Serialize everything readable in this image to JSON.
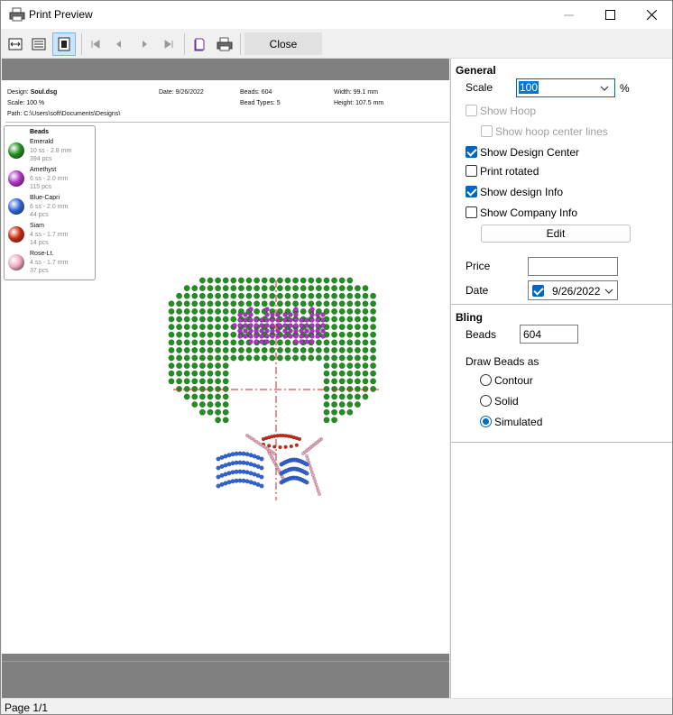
{
  "window": {
    "title": "Print Preview"
  },
  "toolbar": {
    "close_label": "Close"
  },
  "header": {
    "design_label": "Design:",
    "design_value": "Soul.dsg",
    "scale_text": "Scale: 100 %",
    "path_text": "Path: C:\\Users\\soft\\Documents\\Designs\\",
    "date_text": "Date: 9/26/2022",
    "beads_text": "Beads: 604",
    "bead_types_text": "Bead Types: 5",
    "width_text": "Width: 99.1 mm",
    "height_text": "Height: 107.5 mm"
  },
  "legend": {
    "title": "Beads",
    "items": [
      {
        "name": "Emerald",
        "size": "10 ss - 2.8 mm",
        "pcs": "394 pcs",
        "color": "#1f8f1f"
      },
      {
        "name": "Amethyst",
        "size": "6 ss - 2.0 mm",
        "pcs": "115 pcs",
        "color": "#b02fc6"
      },
      {
        "name": "Blue-Capri",
        "size": "6 ss - 2.0 mm",
        "pcs": "44 pcs",
        "color": "#2f63d6"
      },
      {
        "name": "Siam",
        "size": "4 ss - 1.7 mm",
        "pcs": "14 pcs",
        "color": "#c82a10"
      },
      {
        "name": "Rose-Lt.",
        "size": "4 ss - 1.7 mm",
        "pcs": "37 pcs",
        "color": "#f0a8c0"
      }
    ]
  },
  "general": {
    "title": "General",
    "scale_label": "Scale",
    "scale_value": "100",
    "scale_unit": "%",
    "show_hoop": "Show Hoop",
    "show_hoop_center": "Show hoop center lines",
    "show_design_center": "Show Design Center",
    "print_rotated": "Print rotated",
    "show_design_info": "Show design Info",
    "show_company_info": "Show Company Info",
    "edit_label": "Edit",
    "price_label": "Price",
    "price_value": "",
    "date_label": "Date",
    "date_value": "9/26/2022"
  },
  "bling": {
    "title": "Bling",
    "beads_label": "Beads",
    "beads_value": "604",
    "draw_as_label": "Draw Beads as",
    "contour": "Contour",
    "solid": "Solid",
    "simulated": "Simulated",
    "selected": "Simulated"
  },
  "status": {
    "page": "Page 1/1"
  },
  "colors": {
    "accent": "#0067c0",
    "preview_bg": "#808080",
    "center_line": "#d42020"
  }
}
